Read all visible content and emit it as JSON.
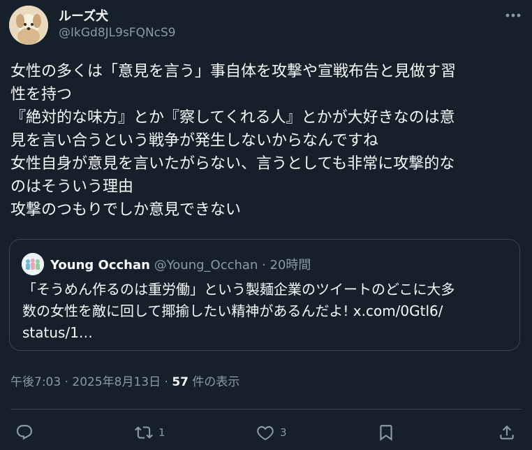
{
  "author": {
    "display_name": "ルーズ犬",
    "handle": "@IkGd8JL9sFQNcS9"
  },
  "tweet": {
    "lines": [
      "女性の多くは「意見を言う」事自体を攻撃や宣戦布告と見做す習",
      "性を持つ",
      "『絶対的な味方』とか『察してくれる人』とかが大好きなのは意",
      "見を言い合うという戦争が発生しないからなんですね",
      "女性自身が意見を言いたがらない、言うとしても非常に攻撃的な",
      "のはそういう理由",
      "攻撃のつもりでしか意見できない"
    ]
  },
  "quote": {
    "name": "Young Occhan",
    "handle": "@Young_Occhan",
    "separator": " · ",
    "time": "20時間",
    "lines": [
      "「そうめん作るのは重労働」という製麺企業のツイートのどこに大多",
      "数の女性を敵に回して揶揄したい精神があるんだよ! x.com/0Gtl6/",
      "status/1…"
    ]
  },
  "meta": {
    "time": "午後7:03",
    "date": "2025年8月13日",
    "separator": " · ",
    "views_count": "57",
    "views_label": " 件の表示"
  },
  "actions": {
    "reply_count": "",
    "retweet_count": "1",
    "like_count": "3"
  },
  "colors": {
    "background": "#15202b",
    "text": "#f7f9f9",
    "muted": "#8b98a5",
    "border": "#38444d"
  },
  "icons": [
    "avatar-dog",
    "more-icon",
    "reply-icon",
    "retweet-icon",
    "like-icon",
    "bookmark-icon",
    "share-icon"
  ]
}
